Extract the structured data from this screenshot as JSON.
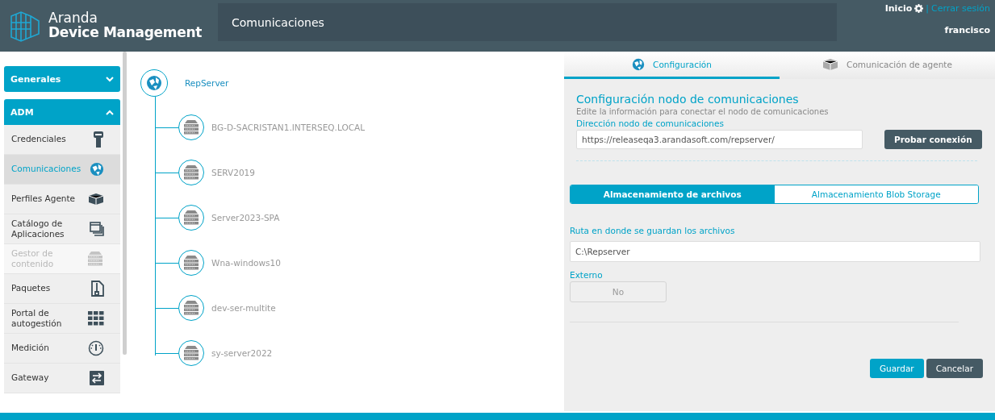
{
  "header": {
    "brand_top": "Aranda",
    "brand_bottom": "Device Management",
    "page_title": "Comunicaciones",
    "home_link": "Inicio",
    "logout_link": "Cerrar sesión",
    "separator": "|",
    "user": "francisco"
  },
  "sidebar": {
    "sections": [
      {
        "label": "Generales",
        "expanded": false
      },
      {
        "label": "ADM",
        "expanded": true,
        "items": [
          {
            "label": "Credenciales",
            "selected": false,
            "disabled": false
          },
          {
            "label": "Comunicaciones",
            "selected": true,
            "disabled": false
          },
          {
            "label": "Perfiles Agente",
            "selected": false,
            "disabled": false
          },
          {
            "label": "Catálogo de Aplicaciones",
            "selected": false,
            "disabled": false
          },
          {
            "label": "Gestor de contenido",
            "selected": false,
            "disabled": true
          },
          {
            "label": "Paquetes",
            "selected": false,
            "disabled": false
          },
          {
            "label": "Portal de autogestión",
            "selected": false,
            "disabled": false
          },
          {
            "label": "Medición",
            "selected": false,
            "disabled": false
          },
          {
            "label": "Gateway",
            "selected": false,
            "disabled": false
          }
        ]
      }
    ]
  },
  "tree": {
    "root": "RepServer",
    "children": [
      {
        "label": "BG-D-SACRISTAN1.INTERSEQ.LOCAL"
      },
      {
        "label": "SERV2019"
      },
      {
        "label": "Server2023-SPA"
      },
      {
        "label": "Wna-windows10"
      },
      {
        "label": "dev-ser-multite"
      },
      {
        "label": "sy-server2022"
      }
    ]
  },
  "panel": {
    "tabs": [
      {
        "label": "Configuración",
        "selected": true
      },
      {
        "label": "Comunicación de agente",
        "selected": false
      }
    ],
    "title": "Configuración nodo de comunicaciones",
    "subtitle": "Edite la información para conectar el nodo de comunicaciones",
    "address_label": "Dirección nodo de comunicaciones",
    "address_value": "https://releaseqa3.arandasoft.com/repserver/",
    "test_button": "Probar conexión",
    "storage_tabs": [
      {
        "label": "Almacenamiento de archivos",
        "selected": true
      },
      {
        "label": "Almacenamiento Blob Storage",
        "selected": false
      }
    ],
    "path_label": "Ruta en donde se guardan los archivos",
    "path_value": "C:\\Repserver",
    "external_label": "Externo",
    "external_value": "No",
    "external_on": false,
    "save_button": "Guardar",
    "cancel_button": "Cancelar"
  }
}
